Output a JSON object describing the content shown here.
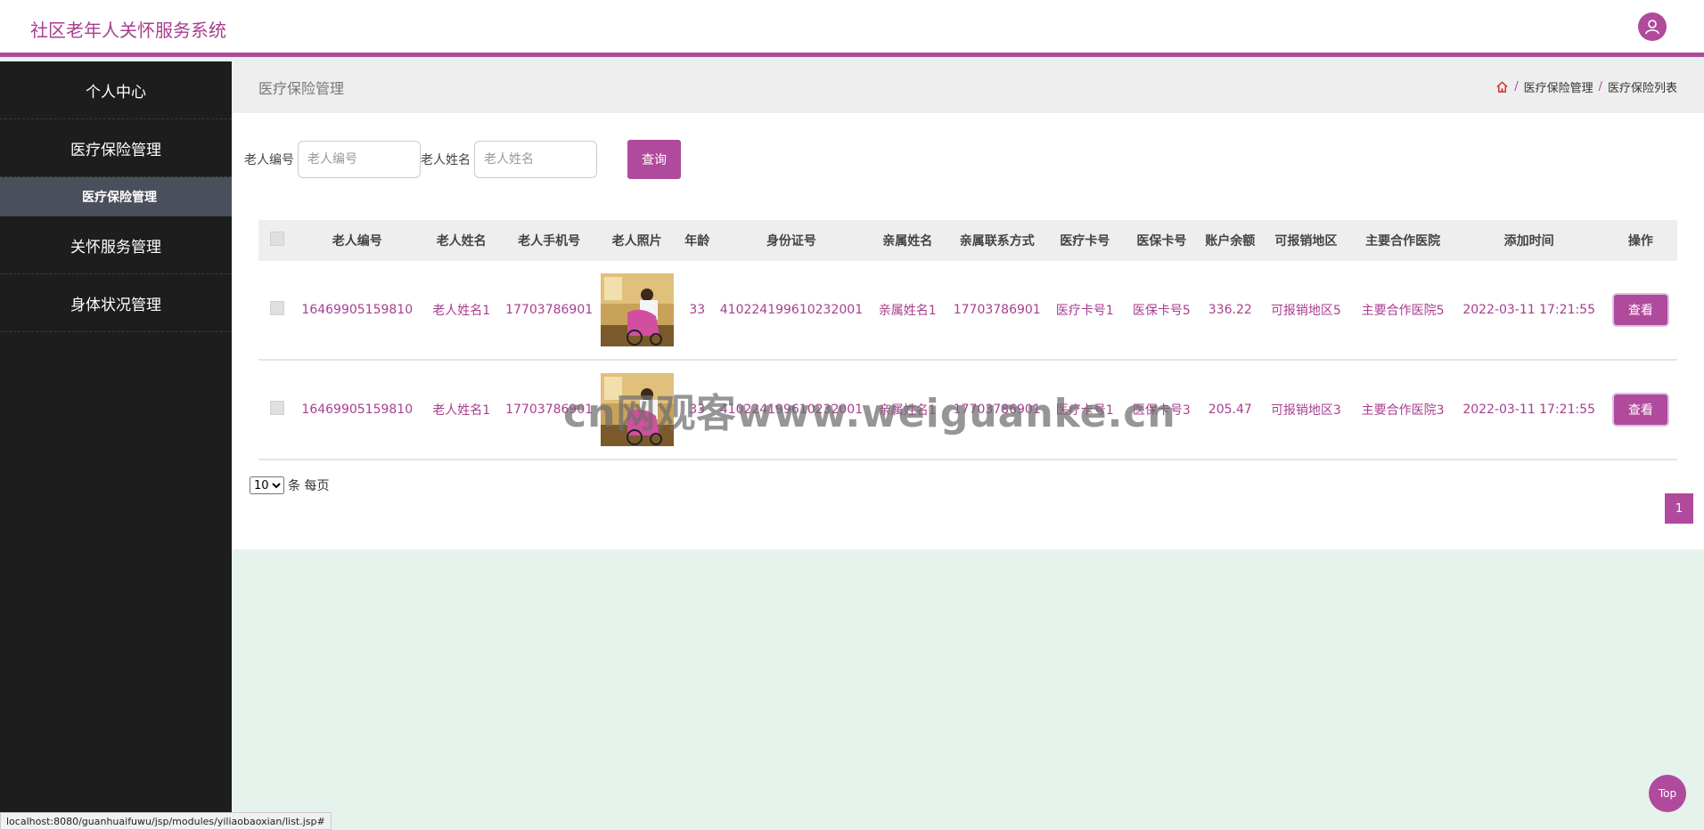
{
  "app": {
    "title": "社区老年人关怀服务系统"
  },
  "sidebar": {
    "items": [
      {
        "label": "个人中心"
      },
      {
        "label": "医疗保险管理"
      },
      {
        "label": "医疗保险管理",
        "sub": true,
        "active": true
      },
      {
        "label": "关怀服务管理"
      },
      {
        "label": "身体状况管理"
      }
    ]
  },
  "page": {
    "title": "医疗保险管理",
    "breadcrumb": [
      "医疗保险管理",
      "医疗保险列表"
    ]
  },
  "search": {
    "field1_label": "老人编号",
    "field1_placeholder": "老人编号",
    "field2_label": "老人姓名",
    "field2_placeholder": "老人姓名",
    "button": "查询"
  },
  "table": {
    "columns": [
      "老人编号",
      "老人姓名",
      "老人手机号",
      "老人照片",
      "年龄",
      "身份证号",
      "亲属姓名",
      "亲属联系方式",
      "医疗卡号",
      "医保卡号",
      "账户余额",
      "可报销地区",
      "主要合作医院",
      "添加时间",
      "操作"
    ],
    "rows": [
      {
        "code": "16469905159810",
        "name": "老人姓名1",
        "phone": "17703786901",
        "age": "33",
        "id_card": "410224199610232001",
        "relative": "亲属姓名1",
        "relative_phone": "17703786901",
        "medical_card": "医疗卡号1",
        "insurance_card": "医保卡号5",
        "balance": "336.22",
        "region": "可报销地区5",
        "hospital": "主要合作医院5",
        "added": "2022-03-11 17:21:55",
        "action": "查看"
      },
      {
        "code": "16469905159810",
        "name": "老人姓名1",
        "phone": "17703786901",
        "age": "33",
        "id_card": "410224199610232001",
        "relative": "亲属姓名1",
        "relative_phone": "17703786901",
        "medical_card": "医疗卡号1",
        "insurance_card": "医保卡号3",
        "balance": "205.47",
        "region": "可报销地区3",
        "hospital": "主要合作医院3",
        "added": "2022-03-11 17:21:55",
        "action": "查看"
      }
    ]
  },
  "pager": {
    "size": "10",
    "size_suffix": "条 每页",
    "current": "1"
  },
  "watermark": "cn网观客www.weiguanke.cn",
  "top_button": "Top",
  "status_url": "localhost:8080/guanhuaifuwu/jsp/modules/yiliaobaoxian/list.jsp#",
  "colors": {
    "accent": "#b04a9c",
    "sidebar": "#1d1d1d",
    "background": "#e6f2ec"
  },
  "icons": {
    "avatar": "user-icon",
    "home": "home-icon"
  }
}
